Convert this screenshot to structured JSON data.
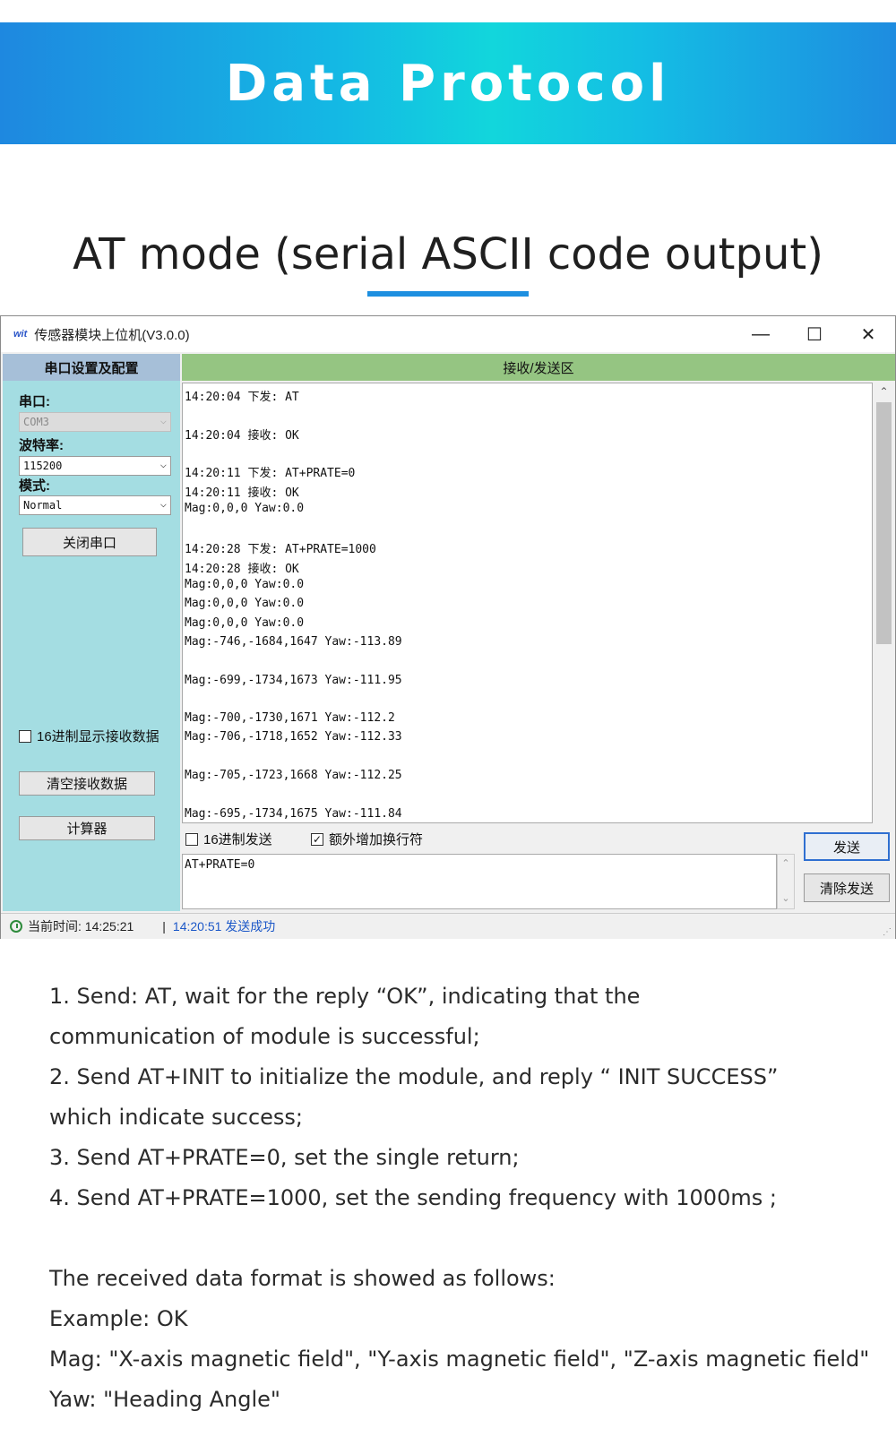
{
  "banner": {
    "title": "Data Protocol"
  },
  "section": {
    "title": "AT mode (serial ASCII code output)"
  },
  "window": {
    "logo": "wit",
    "title": "传感器模块上位机(V3.0.0)",
    "minimize": "—",
    "maximize": "☐",
    "close": "✕"
  },
  "left_panel": {
    "header": "串口设置及配置",
    "port_label": "串口:",
    "port_value": "COM3",
    "baud_label": "波特率:",
    "baud_value": "115200",
    "mode_label": "模式:",
    "mode_value": "Normal",
    "close_port_button": "关闭串口",
    "hex_display_checkbox": "16进制显示接收数据",
    "hex_display_checked": false,
    "clear_receive_button": "清空接收数据",
    "calculator_button": "计算器"
  },
  "right_panel": {
    "header": "接收/发送区",
    "log_lines": [
      "14:20:04 下发: AT",
      "",
      "14:20:04 接收: OK",
      "",
      "14:20:11 下发: AT+PRATE=0",
      "14:20:11 接收: OK",
      "Mag:0,0,0 Yaw:0.0",
      "",
      "14:20:28 下发: AT+PRATE=1000",
      "14:20:28 接收: OK",
      "Mag:0,0,0 Yaw:0.0",
      "Mag:0,0,0 Yaw:0.0",
      "Mag:0,0,0 Yaw:0.0",
      "Mag:-746,-1684,1647 Yaw:-113.89",
      "",
      "Mag:-699,-1734,1673 Yaw:-111.95",
      "",
      "Mag:-700,-1730,1671 Yaw:-112.2",
      "Mag:-706,-1718,1652 Yaw:-112.33",
      "",
      "Mag:-705,-1723,1668 Yaw:-112.25",
      "",
      "Mag:-695,-1734,1675 Yaw:-111.84"
    ],
    "hex_send_checkbox": "16进制发送",
    "hex_send_checked": false,
    "newline_checkbox": "额外增加换行符",
    "newline_checked": true,
    "send_text": "AT+PRATE=0",
    "send_button": "发送",
    "clear_send_button": "清除发送"
  },
  "statusbar": {
    "current_time": "当前时间: 14:25:21",
    "separator": "|",
    "message": "14:20:51 发送成功"
  },
  "description": {
    "lines": [
      "1. Send: AT, wait for the reply “OK”, indicating that the",
      "communication of module is successful;",
      "2. Send AT+INIT to initialize the module, and reply “ INIT SUCCESS”",
      "which indicate success;",
      "3. Send AT+PRATE=0, set the single return;",
      "4. Send AT+PRATE=1000, set the sending frequency with 1000ms ;",
      "",
      "The received data format is showed as follows:",
      "Example: OK",
      "Mag: \"X-axis magnetic field\", \"Y-axis magnetic field\", \"Z-axis magnetic field\"",
      "Yaw: \"Heading Angle\""
    ]
  },
  "colors": {
    "banner_blue": "#1e88e0",
    "banner_cyan": "#12d6dc",
    "left_panel_bg": "#a4dde2",
    "right_header_bg": "#95c582",
    "status_message": "#1c58c8"
  }
}
